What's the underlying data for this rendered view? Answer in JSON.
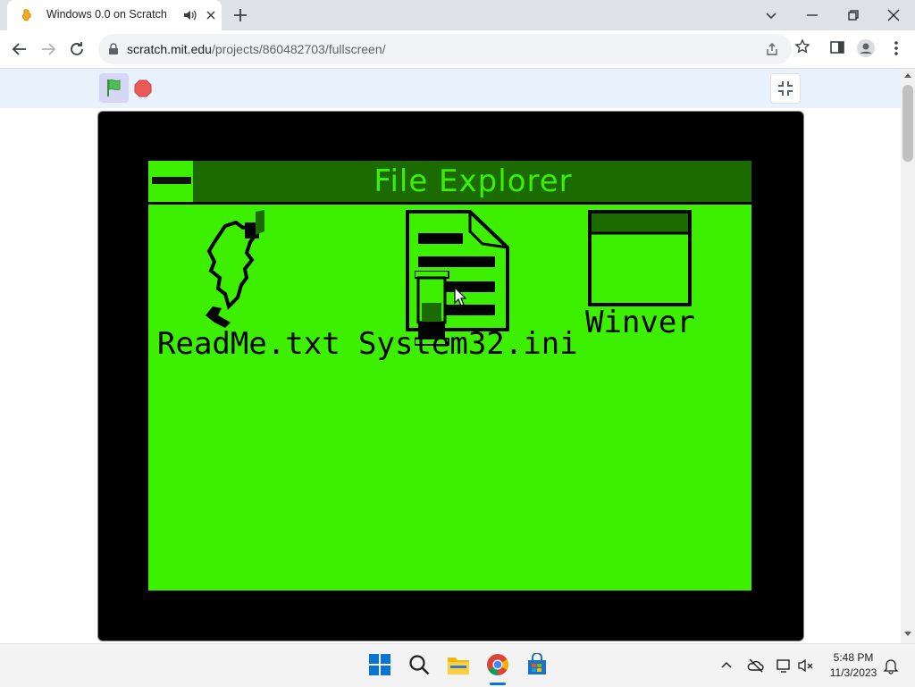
{
  "browser": {
    "tab_title": "Windows 0.0 on Scratch",
    "url_host": "scratch.mit.edu",
    "url_path": "/projects/860482703/fullscreen/"
  },
  "stage": {
    "window_title": "File Explorer",
    "files": [
      {
        "label": "ReadMe.txt",
        "icon": "pencil-scribble-icon"
      },
      {
        "label": "System32.ini",
        "icon": "document-icon"
      },
      {
        "label": "Winver",
        "icon": "window-icon"
      }
    ]
  },
  "taskbar": {
    "time": "5:48 PM",
    "date": "11/3/2023"
  },
  "colors": {
    "stage_green": "#3df000",
    "title_dark_green": "#1b6b00"
  }
}
